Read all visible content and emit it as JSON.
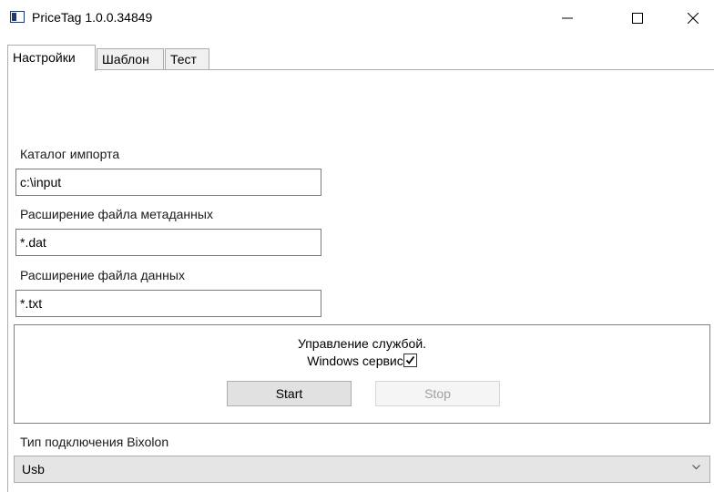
{
  "window": {
    "title": "PriceTag 1.0.0.34849"
  },
  "tabs": [
    {
      "label": "Настройки",
      "active": true
    },
    {
      "label": "Шаблон",
      "active": false
    },
    {
      "label": "Тест",
      "active": false
    }
  ],
  "settings": {
    "import_dir_label": "Каталог импорта",
    "import_dir_value": "c:\\input",
    "meta_ext_label": "Расширение файла метаданных",
    "meta_ext_value": "*.dat",
    "data_ext_label": "Расширение файла данных",
    "data_ext_value": "*.txt"
  },
  "service": {
    "title": "Управление службой.",
    "windows_service_label": "Windows сервис",
    "windows_service_checked": true,
    "start_label": "Start",
    "stop_label": "Stop",
    "stop_enabled": false
  },
  "connection": {
    "label": "Тип подключения Bixolon",
    "selected": "Usb"
  }
}
